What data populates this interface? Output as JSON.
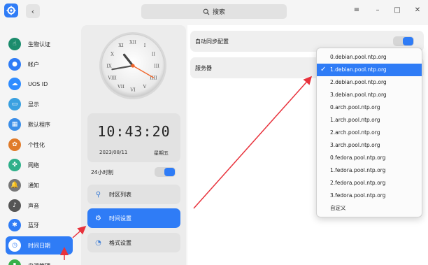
{
  "search": {
    "label": "搜索"
  },
  "window_controls": {
    "menu": "≡",
    "minimize": "–",
    "maximize": "□",
    "close": "✕"
  },
  "sidebar": {
    "items": [
      {
        "label": "生物认证",
        "icon": "fingerprint-icon",
        "color": "#1c8c6c"
      },
      {
        "label": "帐户",
        "icon": "user-icon",
        "color": "#2f7cf6"
      },
      {
        "label": "UOS ID",
        "icon": "cloud-icon",
        "color": "#2f8cff"
      },
      {
        "label": "显示",
        "icon": "monitor-icon",
        "color": "#3aa0e0"
      },
      {
        "label": "默认程序",
        "icon": "default-apps-icon",
        "color": "#3b8ee8"
      },
      {
        "label": "个性化",
        "icon": "palette-icon",
        "color": "#e07b2a"
      },
      {
        "label": "网络",
        "icon": "network-icon",
        "color": "#2fb08a"
      },
      {
        "label": "通知",
        "icon": "bell-icon",
        "color": "#777777"
      },
      {
        "label": "声音",
        "icon": "speaker-icon",
        "color": "#555555"
      },
      {
        "label": "蓝牙",
        "icon": "bluetooth-icon",
        "color": "#2f7cf6"
      },
      {
        "label": "时间日期",
        "icon": "clock-icon",
        "color": "#ffffff",
        "active": true
      },
      {
        "label": "电源管理",
        "icon": "battery-icon",
        "color": "#38b04a"
      }
    ]
  },
  "clock": {
    "hour": 10,
    "minute": 43,
    "second": 20
  },
  "digital": {
    "time": "10:43:20",
    "date": "2023/08/11",
    "weekday": "星期五"
  },
  "toggle24": {
    "label": "24小时制",
    "on": true
  },
  "mid_menu": [
    {
      "label": "时区列表",
      "icon": "pin-icon"
    },
    {
      "label": "时间设置",
      "icon": "gear-icon",
      "active": true
    },
    {
      "label": "格式设置",
      "icon": "format-icon"
    }
  ],
  "settings": {
    "auto_sync": {
      "label": "自动同步配置",
      "on": true
    },
    "server": {
      "label": "服务器"
    }
  },
  "server_options": {
    "items": [
      "0.debian.pool.ntp.org",
      "1.debian.pool.ntp.org",
      "2.debian.pool.ntp.org",
      "3.debian.pool.ntp.org",
      "0.arch.pool.ntp.org",
      "1.arch.pool.ntp.org",
      "2.arch.pool.ntp.org",
      "3.arch.pool.ntp.org",
      "0.fedora.pool.ntp.org",
      "1.fedora.pool.ntp.org",
      "2.fedora.pool.ntp.org",
      "3.fedora.pool.ntp.org",
      "自定义"
    ],
    "selected_index": 1
  },
  "accent_color": "#2f7cf6",
  "annotation_color": "#e8323c"
}
